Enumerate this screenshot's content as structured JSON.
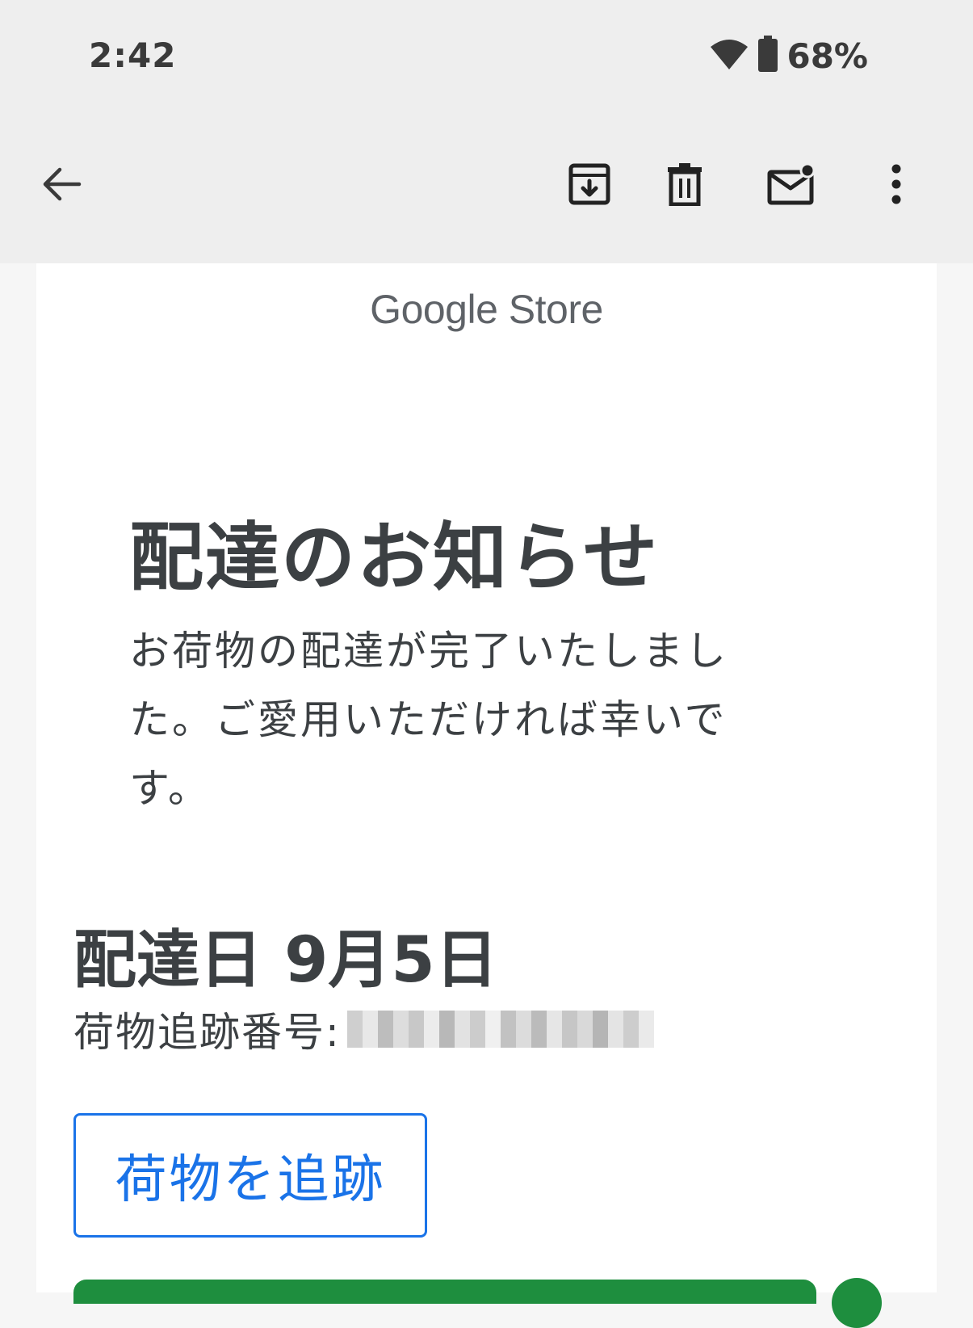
{
  "status_bar": {
    "time": "2:42",
    "battery_percent": "68%",
    "wifi_icon": "wifi-icon",
    "battery_icon": "battery-icon"
  },
  "toolbar": {
    "icons": [
      "back-arrow-icon",
      "archive-icon",
      "delete-icon",
      "mark-unread-icon",
      "more-vert-icon"
    ]
  },
  "email": {
    "sender_logo": "Google Store",
    "title": "配達のお知らせ",
    "body": "お荷物の配達が完了いたしました。ご愛用いただければ幸いです。",
    "delivery_date": "配達日 9月5日",
    "tracking_label": "荷物追跡番号:",
    "track_button_label": "荷物を追跡"
  },
  "colors": {
    "primary_blue": "#1a73e8",
    "green_accent": "#1e8e3e",
    "text_dark": "#3c4043",
    "logo_gray": "#5f6368",
    "bar_bg": "#eeeeee"
  }
}
